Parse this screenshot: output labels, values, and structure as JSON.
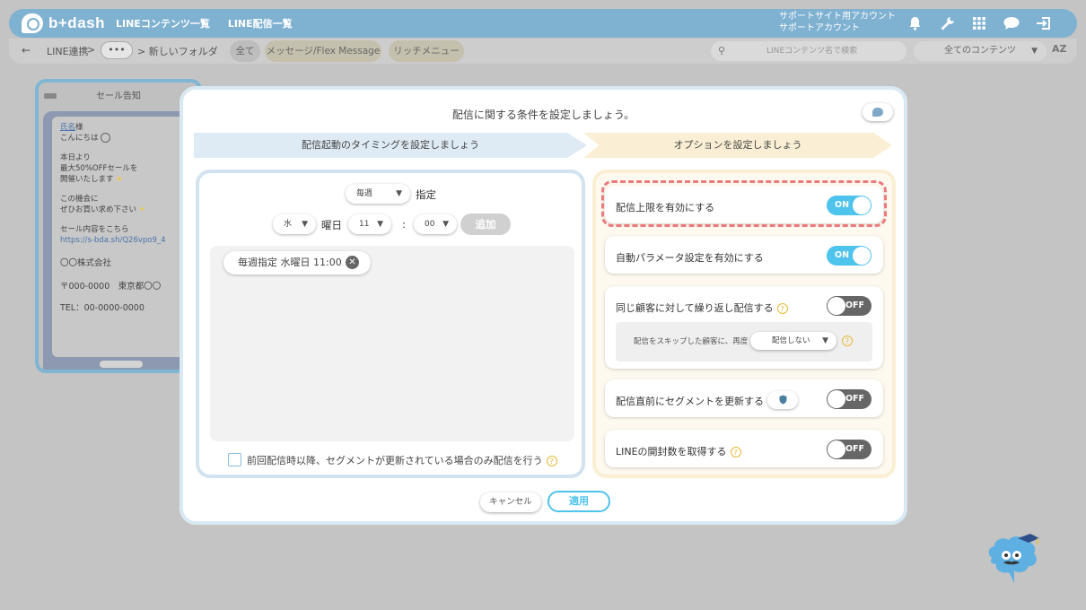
{
  "header": {
    "logo": "b+dash",
    "nav": [
      "LINEコンテンツ一覧",
      "LINE配信一覧"
    ],
    "account_line1": "サポートサイト用アカウント",
    "account_line2": "サポートアカウント",
    "icons": [
      "bell-icon",
      "wrench-icon",
      "grid-icon",
      "chat-icon",
      "logout-icon"
    ]
  },
  "subbar": {
    "breadcrumb_root": "LINE連携",
    "breadcrumb_sep": ">",
    "breadcrumb_more": "•••",
    "breadcrumb_folder": "> 新しいフォルダ",
    "filters": [
      "全て",
      "メッセージ/Flex Message",
      "リッチメニュー"
    ],
    "search_placeholder": "LINEコンテンツ名で検索",
    "content_filter": "全てのコンテンツ",
    "sort_label": "AZ"
  },
  "preview_card": {
    "title": "セール告知",
    "name_tag": "氏名",
    "name_suffix": "様",
    "greeting": "こんにちは",
    "line_a1": "本日より",
    "line_a2": "最大50%OFFセールを",
    "line_a3": "開催いたします",
    "line_b1": "この機会に",
    "line_b2": "ぜひお買い求め下さい",
    "line_c1": "セール内容をこちら",
    "link": "https://s-bda.sh/Q26vpo9_4",
    "company": "〇〇株式会社",
    "address": "〒000-0000　東京都〇〇",
    "tel": "TEL：00-0000-0000"
  },
  "modal": {
    "title": "配信に関する条件を設定しましょう。",
    "step1": "配信起動のタイミングを設定しましょう",
    "step2": "オプションを設定しましょう",
    "schedule": {
      "frequency": "毎週",
      "frequency_suffix": "指定",
      "weekday": "水",
      "weekday_suffix": "曜日",
      "hour": "11",
      "colon": ":",
      "minute": "00",
      "add_label": "追加",
      "chips": [
        "毎週指定 水曜日 11:00"
      ]
    },
    "segment_only_label": "前回配信時以降、セグメントが更新されている場合のみ配信を行う",
    "options": [
      {
        "label": "配信上限を有効にする",
        "state": "ON"
      },
      {
        "label": "自動パラメータ設定を有効にする",
        "state": "ON"
      },
      {
        "label": "同じ顧客に対して繰り返し配信する",
        "state": "OFF",
        "sub_label": "配信をスキップした顧客に、再度",
        "sub_value": "配信しない"
      },
      {
        "label": "配信直前にセグメントを更新する",
        "state": "OFF"
      },
      {
        "label": "LINEの開封数を取得する",
        "state": "OFF"
      }
    ],
    "help_glyph": "?",
    "cancel_label": "キャンセル",
    "apply_label": "適用"
  },
  "colors": {
    "accent": "#4ec3ec",
    "header": "#7fb1d1",
    "highlight_dash": "#ec7a7f"
  }
}
